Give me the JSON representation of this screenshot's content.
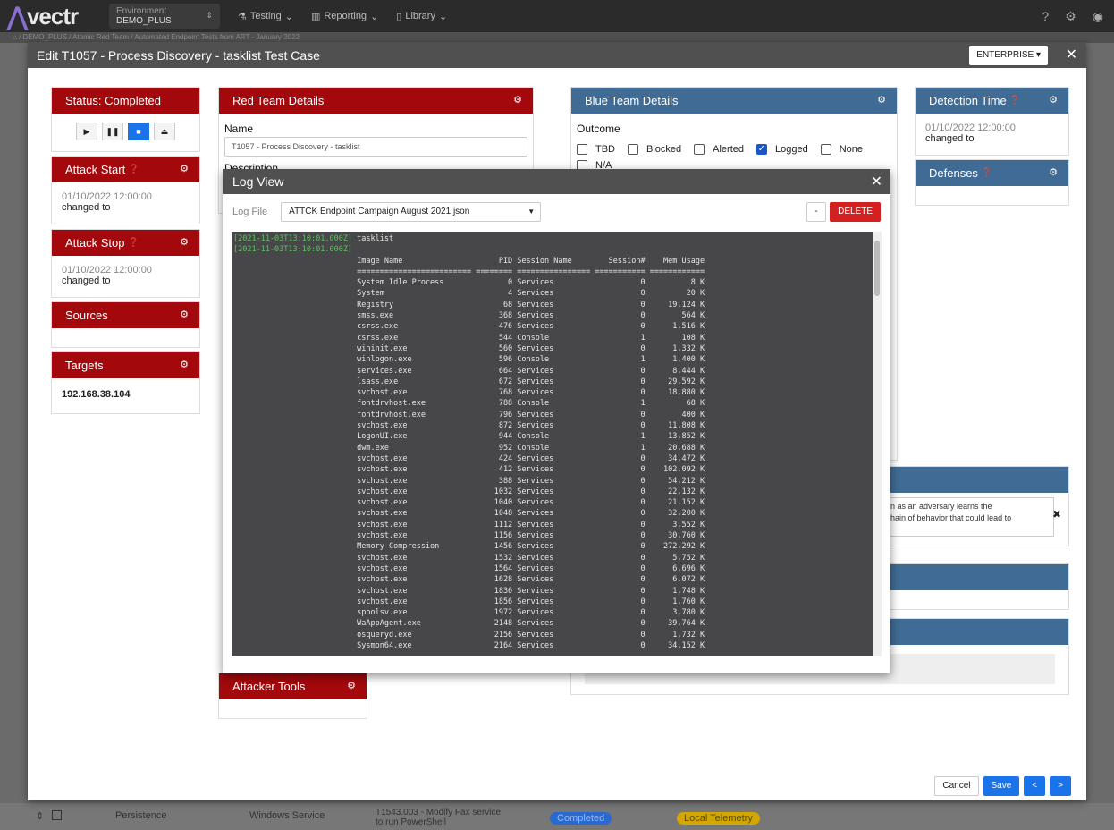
{
  "app": {
    "logo_text": "vectr",
    "project_label": "Environment",
    "project_value": "DEMO_PLUS",
    "nav": [
      "Testing",
      "Reporting",
      "Library"
    ],
    "breadcrumb": [
      "DEMO_PLUS",
      "Atomic Red Team",
      "Automated Endpoint Tests from ART - January 2022"
    ]
  },
  "modal": {
    "title": "Edit T1057 - Process Discovery - tasklist Test Case",
    "env_button": "ENTERPRISE"
  },
  "status": {
    "title": "Status: Completed"
  },
  "attack_start": {
    "title": "Attack Start",
    "date": "01/10/2022 12:00:00",
    "changed": "changed to"
  },
  "attack_stop": {
    "title": "Attack Stop",
    "date": "01/10/2022 12:00:00",
    "changed": "changed to"
  },
  "sources": {
    "title": "Sources"
  },
  "targets": {
    "title": "Targets",
    "value": "192.168.38.104"
  },
  "red_team": {
    "title": "Red Team Details",
    "name_label": "Name",
    "name_value": "T1057 - Process Discovery - tasklist",
    "desc_label": "Description"
  },
  "attacker_tools": {
    "title": "Attacker Tools"
  },
  "blue_team": {
    "title": "Blue Team Details",
    "outcome_label": "Outcome",
    "outcomes": [
      "TBD",
      "Blocked",
      "Alerted",
      "Logged",
      "None"
    ],
    "selected": "Logged",
    "na_label": "N/A"
  },
  "detection_time": {
    "title": "Detection Time",
    "date": "01/10/2022 12:00:00",
    "changed": "changed to"
  },
  "defenses": {
    "title": "Defenses"
  },
  "hidden_text": {
    "line1": "n as an adversary learns the",
    "line2": "hain of behavior that could lead to"
  },
  "log_view": {
    "title": "Log View",
    "log_file_label": "Log File",
    "log_file_value": "ATTCK Endpoint Campaign August 2021.json",
    "minus_label": "-",
    "delete_label": "DELETE",
    "timestamps": [
      "[2021-11-03T13:10:01.000Z]",
      "[2021-11-03T13:10:01.000Z]"
    ],
    "lines": [
      "tasklist",
      "",
      "Image Name                     PID Session Name        Session#    Mem Usage",
      "========================= ======== ================ =========== ============",
      "System Idle Process              0 Services                   0          8 K",
      "System                           4 Services                   0         20 K",
      "Registry                        68 Services                   0     19,124 K",
      "smss.exe                       368 Services                   0        564 K",
      "csrss.exe                      476 Services                   0      1,516 K",
      "csrss.exe                      544 Console                    1        108 K",
      "wininit.exe                    560 Services                   0      1,332 K",
      "winlogon.exe                   596 Console                    1      1,400 K",
      "services.exe                   664 Services                   0      8,444 K",
      "lsass.exe                      672 Services                   0     29,592 K",
      "svchost.exe                    768 Services                   0     18,880 K",
      "fontdrvhost.exe                788 Console                    1         68 K",
      "fontdrvhost.exe                796 Services                   0        400 K",
      "svchost.exe                    872 Services                   0     11,808 K",
      "LogonUI.exe                    944 Console                    1     13,852 K",
      "dwm.exe                        952 Console                    1     20,688 K",
      "svchost.exe                    424 Services                   0     34,472 K",
      "svchost.exe                    412 Services                   0    102,092 K",
      "svchost.exe                    388 Services                   0     54,212 K",
      "svchost.exe                   1032 Services                   0     22,132 K",
      "svchost.exe                   1040 Services                   0     21,152 K",
      "svchost.exe                   1048 Services                   0     32,200 K",
      "svchost.exe                   1112 Services                   0      3,552 K",
      "svchost.exe                   1156 Services                   0     30,760 K",
      "Memory Compression            1456 Services                   0    272,292 K",
      "svchost.exe                   1532 Services                   0      5,752 K",
      "svchost.exe                   1564 Services                   0      6,696 K",
      "svchost.exe                   1628 Services                   0      6,072 K",
      "svchost.exe                   1836 Services                   0      1,748 K",
      "svchost.exe                   1856 Services                   0      1,760 K",
      "spoolsv.exe                   1972 Services                   0      3,780 K",
      "WaAppAgent.exe                2148 Services                   0     39,764 K",
      "osqueryd.exe                  2156 Services                   0      1,732 K",
      "Sysmon64.exe                  2164 Services                   0     34,152 K"
    ]
  },
  "footer": {
    "cancel": "Cancel",
    "save": "Save",
    "prev": "<",
    "next": ">"
  },
  "bg_row": {
    "phase": "Persistence",
    "technique": "Windows Service",
    "name": "T1543.003 - Modify Fax service to run PowerShell",
    "status": "Completed",
    "outcome": "Local Telemetry"
  }
}
